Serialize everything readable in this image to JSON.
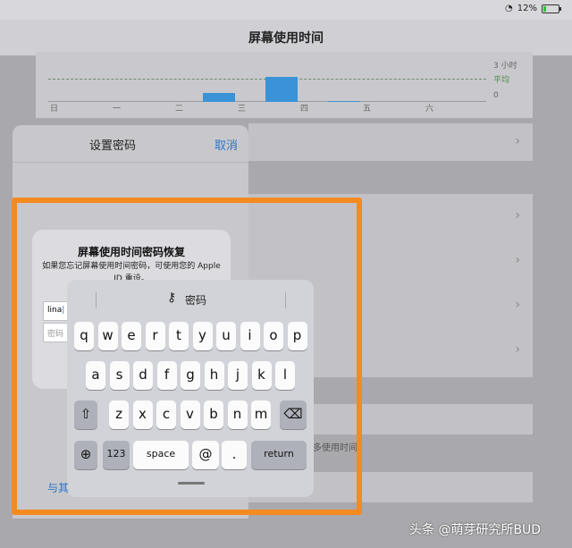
{
  "status": {
    "battery": "12%"
  },
  "nav": {
    "title": "屏幕使用时间"
  },
  "chart_data": {
    "type": "bar",
    "categories": [
      "日",
      "一",
      "二",
      "三",
      "四",
      "五",
      "六"
    ],
    "values": [
      0,
      0,
      0.55,
      1.6,
      0.03,
      0.02,
      0
    ],
    "ylabels": [
      "3 小时",
      "0"
    ],
    "average_label": "平均",
    "ylim": [
      0,
      3
    ]
  },
  "background": {
    "footer_note": "多使用时间。"
  },
  "sheet": {
    "title": "设置密码",
    "cancel": "取消"
  },
  "alert": {
    "title": "屏幕使用时间密码恢复",
    "message": "如果您忘记屏幕使用时间密码，可使用您的 Apple ID 重设。",
    "username_value": "lina",
    "password_placeholder": "密码"
  },
  "keyboard": {
    "bar_label": "密码",
    "row1": [
      "q",
      "w",
      "e",
      "r",
      "t",
      "y",
      "u",
      "i",
      "o",
      "p"
    ],
    "row2": [
      "a",
      "s",
      "d",
      "f",
      "g",
      "h",
      "j",
      "k",
      "l"
    ],
    "row3": [
      "z",
      "x",
      "c",
      "v",
      "b",
      "n",
      "m"
    ],
    "numbers": "123",
    "space": "space",
    "at": "@",
    "dot": ".",
    "return": "return"
  },
  "link": {
    "text": "与其"
  },
  "watermark": "头条 @萌芽研究所BUD",
  "colors": {
    "highlight": "#f58a1f",
    "link": "#2f74c6",
    "bar": "#3a93d6"
  }
}
